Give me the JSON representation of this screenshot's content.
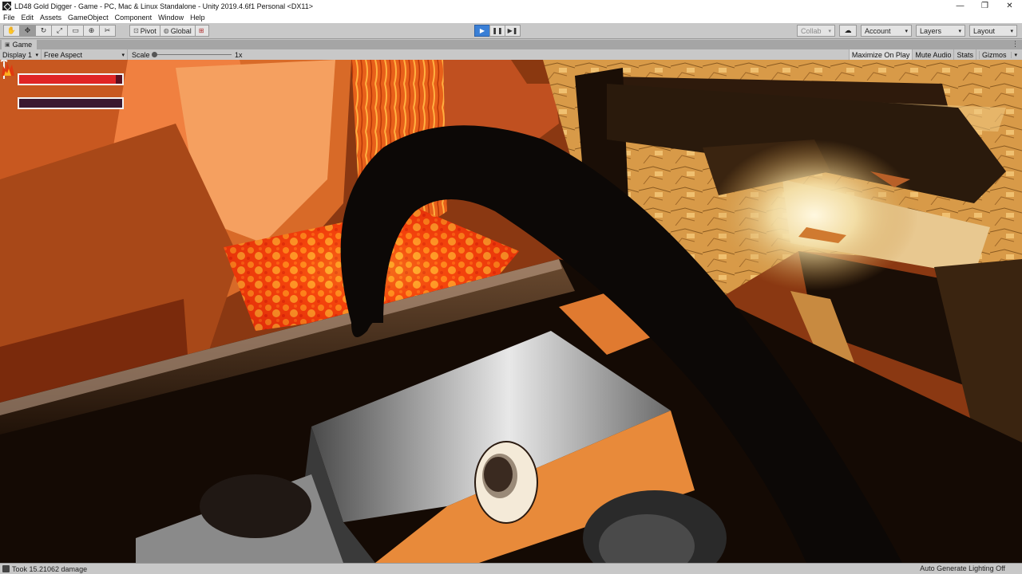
{
  "window": {
    "title": "LD48 Gold Digger - Game - PC, Mac & Linux Standalone - Unity 2019.4.6f1 Personal <DX11>",
    "controls": {
      "minimize": "—",
      "restore": "❐",
      "close": "✕"
    }
  },
  "menu": {
    "items": [
      "File",
      "Edit",
      "Assets",
      "GameObject",
      "Component",
      "Window",
      "Help"
    ]
  },
  "toolbar": {
    "tools": [
      "hand-tool-icon",
      "move-tool-icon",
      "rotate-tool-icon",
      "scale-tool-icon",
      "rect-tool-icon",
      "transform-tool-icon",
      "custom-tool-icon"
    ],
    "tool_glyphs": [
      "✋",
      "✥",
      "↻",
      "⤢",
      "▭",
      "⊕",
      "✂"
    ],
    "pivot_label": "Pivot",
    "global_label": "Global",
    "play_glyphs": {
      "play": "▶",
      "pause": "❚❚",
      "step": "▶❚"
    },
    "collab_label": "Collab",
    "account_label": "Account",
    "layers_label": "Layers",
    "layout_label": "Layout"
  },
  "game_view": {
    "tab_label": "Game",
    "display_label": "Display 1",
    "aspect_label": "Free Aspect",
    "scale_label": "Scale",
    "scale_value": "1x",
    "options": [
      "Maximize On Play",
      "Mute Audio",
      "Stats",
      "Gizmos"
    ],
    "highlighted_option": "Maximize On Play"
  },
  "hud": {
    "health_fraction": 0.94,
    "heat_fraction": 0.0,
    "colors": {
      "health": "#e02525",
      "heat": "#e0602a",
      "frame": "#f4f4f4"
    }
  },
  "status": {
    "message": "Took 15.21062 damage",
    "lighting": "Auto Generate Lighting Off"
  },
  "colors": {
    "accent": "#3a7fd6",
    "lava": "#ff4a10",
    "rock": "#e07830"
  }
}
